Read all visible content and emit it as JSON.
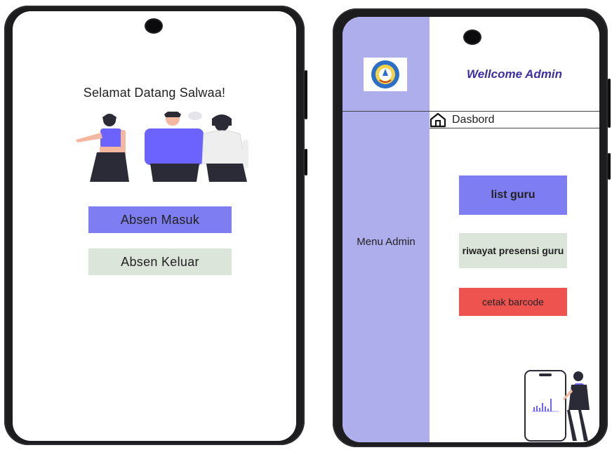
{
  "left_screen": {
    "greeting": "Selamat Datang Salwaa!",
    "absen_masuk_label": "Absen Masuk",
    "absen_keluar_label": "Absen Keluar"
  },
  "right_screen": {
    "welcome": "Wellcome Admin",
    "nav_dasbord_label": "Dasbord",
    "sidebar_label": "Menu Admin",
    "list_guru_label": "list guru",
    "riwayat_label": "riwayat presensi guru",
    "cetak_label": "cetak barcode"
  },
  "colors": {
    "primary_button": "#7e7df2",
    "secondary_button": "#dbe5da",
    "danger_button": "#ef5350",
    "sidebar": "#aeaeec",
    "welcome_text": "#3b2fa3"
  },
  "icons": {
    "dashboard": "home-icon",
    "logo": "school-logo-icon"
  }
}
